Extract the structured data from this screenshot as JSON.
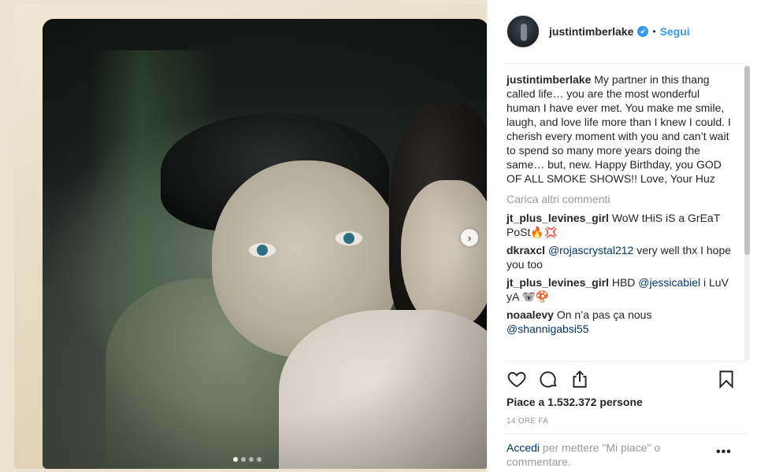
{
  "post": {
    "username": "justintimberlake",
    "verified_label": "✔",
    "separator": "•",
    "follow_label": "Segui",
    "caption": "My partner in this thang called life… you are the most wonderful human I have ever met. You make me smile, laugh, and love life more than I knew I could. I cherish every moment with you and can’t wait to spend so many more years doing the same… but, new. Happy Birthday, you GOD OF ALL SMOKE SHOWS!! Love, Your Huz",
    "load_more_label": "Carica altri commenti",
    "comments": [
      {
        "user": "jt_plus_levines_girl",
        "text": "WoW tHiS iS a GrEaT PoSt🔥💢"
      },
      {
        "user": "dkraxcl",
        "mention": "@rojascrystal212",
        "text": " very well thx I hope you too"
      },
      {
        "user": "jt_plus_levines_girl",
        "pre": "HBD ",
        "mention": "@jessicabiel",
        "text": " i LuV yA 🐨🍄"
      },
      {
        "user": "noaalevy",
        "pre": "On n’a pas ça nous ",
        "mention": "@shannigabsi55",
        "text": ""
      }
    ],
    "likes_label": "Piace a 1.532.372 persone",
    "timestamp": "14 ORE FA",
    "login_link": "Accedi",
    "login_text": " per mettere \"Mi piace\" o commentare.",
    "more_label": "•••",
    "next_label": "›",
    "carousel": {
      "total": 4,
      "active": 1
    }
  },
  "icons": {
    "like": "heart-icon",
    "comment": "comment-icon",
    "share": "share-icon",
    "save": "bookmark-icon",
    "verified": "verified-badge-icon"
  },
  "colors": {
    "accent": "#3897f0",
    "mention": "#003569",
    "muted": "#999999",
    "text": "#262626"
  }
}
